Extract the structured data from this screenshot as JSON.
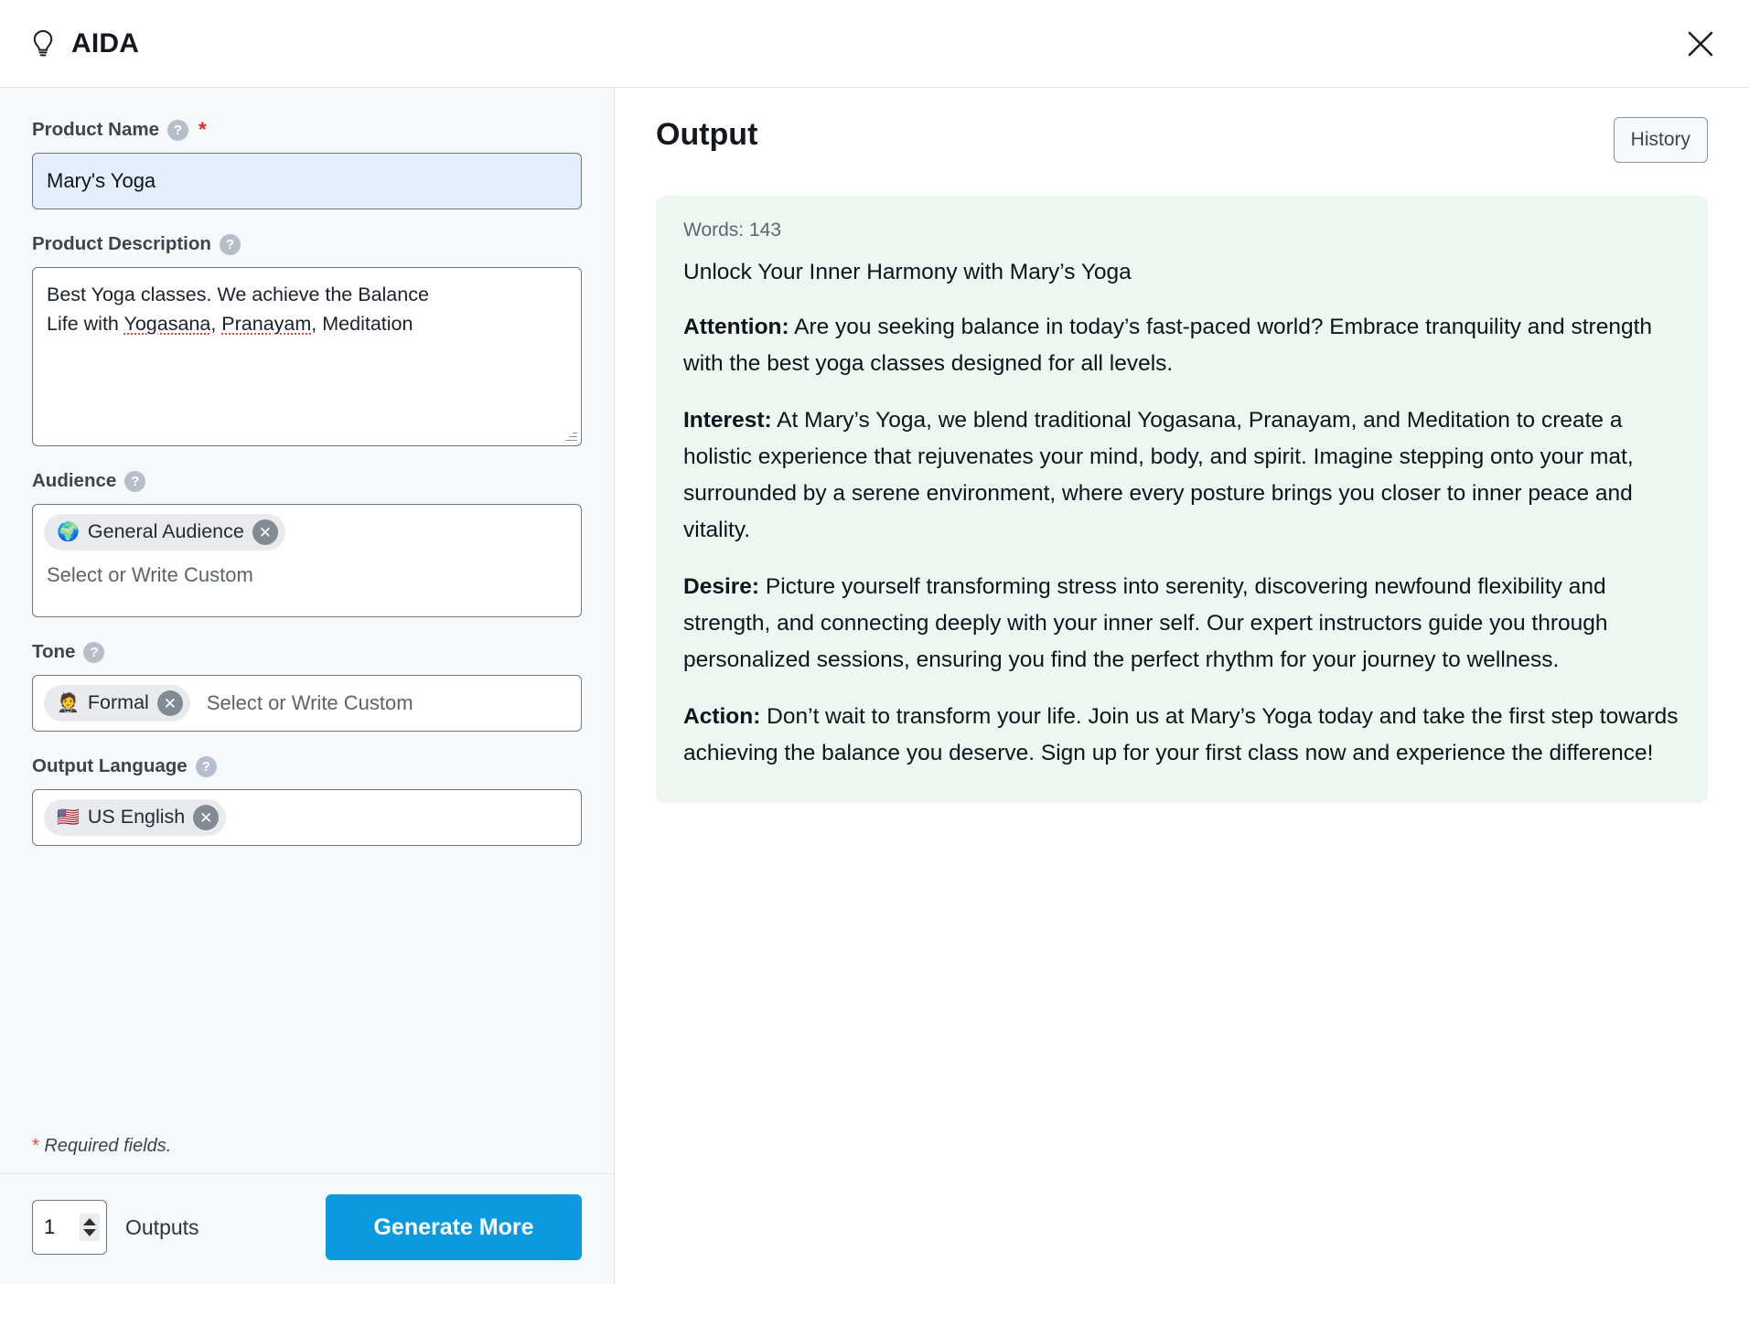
{
  "header": {
    "title": "AIDA",
    "bulb_icon": "lightbulb-icon",
    "close_icon": "close-icon"
  },
  "form": {
    "product_name": {
      "label": "Product Name",
      "required_marker": "*",
      "value": "Mary's Yoga",
      "help": "?"
    },
    "product_description": {
      "label": "Product Description",
      "help": "?",
      "line1": "Best Yoga classes. We achieve the Balance",
      "line2_prefix": "Life with ",
      "misspelled_1": "Yogasana",
      "line2_mid": ", ",
      "misspelled_2": "Pranayam",
      "line2_suffix": ", Meditation",
      "value": "Best Yoga classes. We achieve the Balance Life with Yogasana, Pranayam, Meditation"
    },
    "audience": {
      "label": "Audience",
      "help": "?",
      "chip_emoji": "🌍",
      "chip_label": "General Audience",
      "chip_remove": "✕",
      "placeholder": "Select or Write Custom"
    },
    "tone": {
      "label": "Tone",
      "help": "?",
      "chip_emoji": "🤵",
      "chip_label": "Formal",
      "chip_remove": "✕",
      "placeholder": "Select or Write Custom"
    },
    "output_language": {
      "label": "Output Language",
      "help": "?",
      "chip_emoji": "🇺🇸",
      "chip_label": "US English",
      "chip_remove": "✕"
    },
    "required_note_star": "*",
    "required_note_text": " Required fields.",
    "footer": {
      "outputs_value": "1",
      "outputs_label": "Outputs",
      "generate_label": "Generate More"
    }
  },
  "output": {
    "title": "Output",
    "history_label": "History",
    "words_label": "Words: 143",
    "heading": "Unlock Your Inner Harmony with Mary’s Yoga",
    "paragraphs": [
      {
        "lead": "Attention:",
        "text": " Are you seeking balance in today’s fast-paced world? Embrace tranquility and strength with the best yoga classes designed for all levels."
      },
      {
        "lead": "Interest:",
        "text": " At Mary’s Yoga, we blend traditional Yogasana, Pranayam, and Meditation to create a holistic experience that rejuvenates your mind, body, and spirit. Imagine stepping onto your mat, surrounded by a serene environment, where every posture brings you closer to inner peace and vitality."
      },
      {
        "lead": "Desire:",
        "text": " Picture yourself transforming stress into serenity, discovering newfound flexibility and strength, and connecting deeply with your inner self. Our expert instructors guide you through personalized sessions, ensuring you find the perfect rhythm for your journey to wellness."
      },
      {
        "lead": "Action:",
        "text": " Don’t wait to transform your life. Join us at Mary’s Yoga today and take the first step towards achieving the balance you deserve. Sign up for your first class now and experience the difference!"
      }
    ]
  },
  "colors": {
    "accent_blue": "#0b9ae0",
    "panel_bg": "#f7f8fa",
    "output_card_bg": "#eef6f2",
    "focus_input_bg": "#e4edfb",
    "required_red": "#e8262a"
  }
}
